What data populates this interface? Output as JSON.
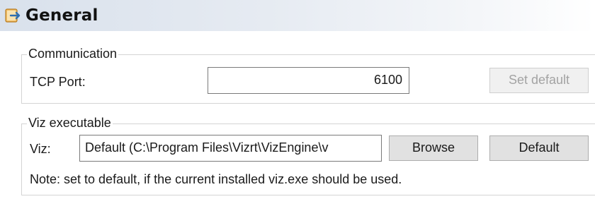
{
  "header": {
    "title": "General",
    "icon": "settings-plug-icon"
  },
  "communication": {
    "legend": "Communication",
    "tcp_port_label": "TCP Port:",
    "tcp_port_value": "6100",
    "set_default_label": "Set default"
  },
  "viz_executable": {
    "legend": "Viz executable",
    "viz_label": "Viz:",
    "viz_path_value": "Default (C:\\Program Files\\Vizrt\\VizEngine\\v",
    "browse_label": "Browse",
    "default_label": "Default",
    "note": "Note: set to default, if the current installed viz.exe should be used."
  },
  "colors": {
    "header_gradient_start": "#d9e1ec",
    "icon_accent": "#e8a33a",
    "disabled_text": "#a3a3a3"
  }
}
